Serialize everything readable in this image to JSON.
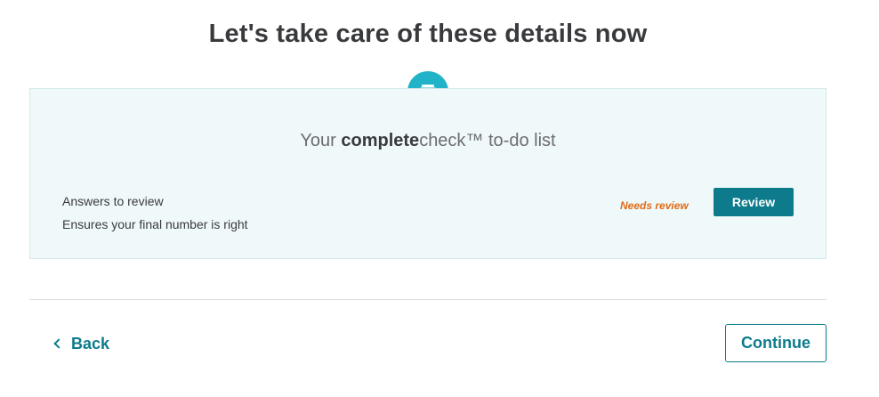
{
  "page": {
    "title": "Let's take care of these details now"
  },
  "card": {
    "icon": "wallet-icon",
    "heading_prefix": "Your ",
    "heading_brand_bold": "complete",
    "heading_brand_rest": "check™",
    "heading_suffix": " to-do list",
    "items": [
      {
        "title": "Answers to review",
        "description": "Ensures your final number is right",
        "status": "Needs review",
        "action_label": "Review"
      }
    ]
  },
  "footer": {
    "back_label": "Back",
    "continue_label": "Continue"
  },
  "colors": {
    "accent": "#0d7b8b",
    "icon_circle": "#21b3c7",
    "card_bg": "#f0f9f9",
    "status_warning": "#e06b16",
    "text": "#393a3d"
  }
}
